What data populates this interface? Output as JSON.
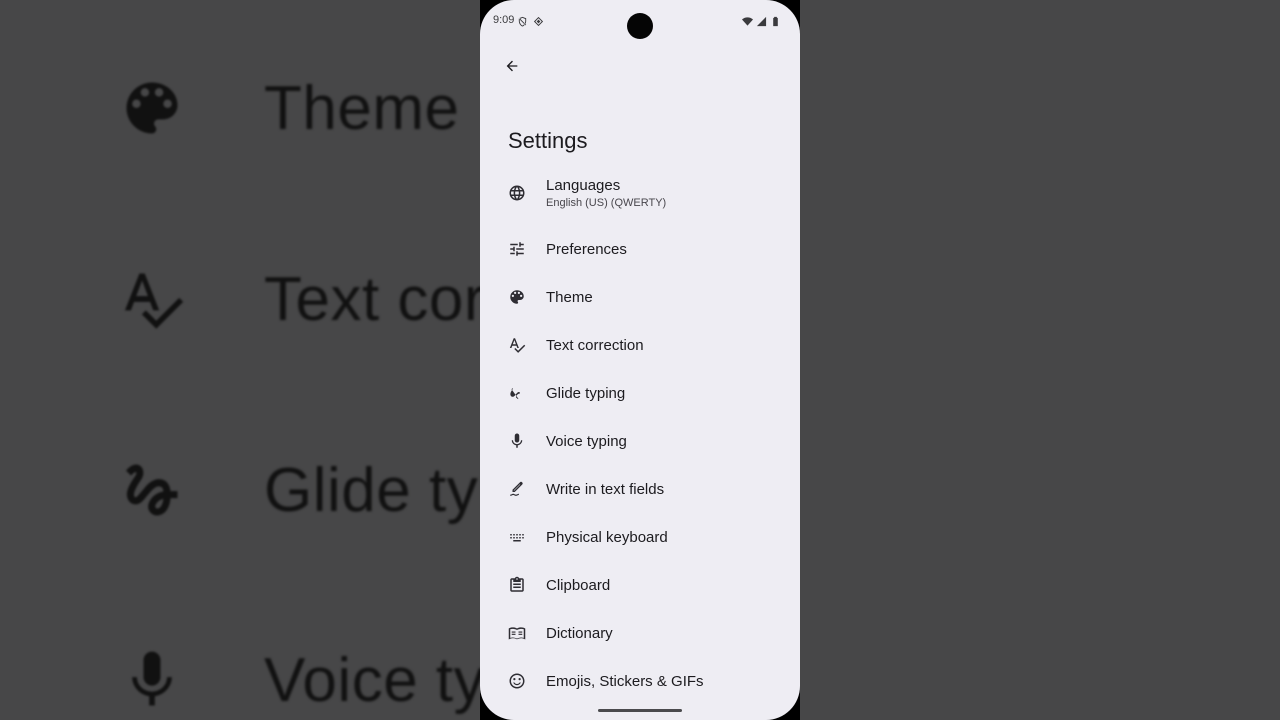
{
  "status_bar": {
    "time": "9:09"
  },
  "header": {
    "title": "Settings"
  },
  "settings": {
    "items": [
      {
        "label": "Languages",
        "subtitle": "English (US) (QWERTY)",
        "icon": "globe-icon"
      },
      {
        "label": "Preferences",
        "icon": "tune-icon"
      },
      {
        "label": "Theme",
        "icon": "palette-icon"
      },
      {
        "label": "Text correction",
        "icon": "spellcheck-icon"
      },
      {
        "label": "Glide typing",
        "icon": "gesture-icon"
      },
      {
        "label": "Voice typing",
        "icon": "mic-icon"
      },
      {
        "label": "Write in text fields",
        "icon": "pen-icon"
      },
      {
        "label": "Physical keyboard",
        "icon": "keyboard-icon"
      },
      {
        "label": "Clipboard",
        "icon": "clipboard-icon"
      },
      {
        "label": "Dictionary",
        "icon": "book-icon"
      },
      {
        "label": "Emojis, Stickers & GIFs",
        "icon": "smiley-icon"
      }
    ]
  },
  "background": {
    "left_labels": [
      "Theme",
      "Text cor",
      "Glide ty",
      "Voice ty"
    ]
  },
  "colors": {
    "phone_bg": "#eeedf3",
    "side_bg": "#474748",
    "text": "#1c1b1f"
  }
}
